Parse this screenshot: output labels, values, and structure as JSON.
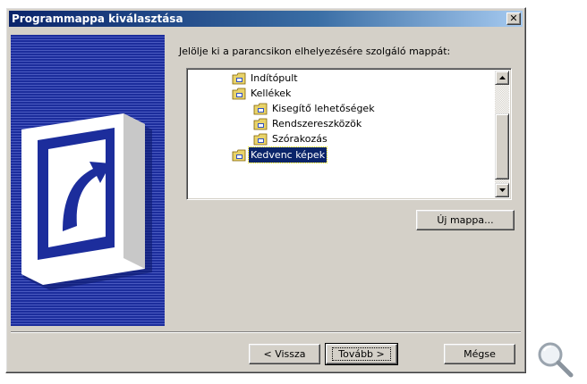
{
  "dialog": {
    "title": "Programmappa kiválasztása",
    "close_label": "✕"
  },
  "prompt": "Jelölje ki a parancsikon elhelyezésére szolgáló mappát:",
  "tree": {
    "items": [
      {
        "label": "Indítópult",
        "selected": false
      },
      {
        "label": "Kellékek",
        "selected": false
      },
      {
        "label": "Kisegítő lehetőségek",
        "selected": false
      },
      {
        "label": "Rendszereszközök",
        "selected": false
      },
      {
        "label": "Szórakozás",
        "selected": false
      },
      {
        "label": "Kedvenc képek",
        "selected": true
      }
    ]
  },
  "buttons": {
    "new_folder": "Új mappa...",
    "back": "< Vissza",
    "next": "Tovább >",
    "cancel": "Mégse"
  },
  "icons": {
    "folder": "program-folder-icon",
    "shortcut": "shortcut-arrow-icon",
    "zoom": "magnifier-icon"
  },
  "colors": {
    "face": "#d4d0c8",
    "title_start": "#0a246a",
    "title_end": "#a6caf0",
    "banner": "#1c2d9c",
    "selection": "#0a246a"
  }
}
